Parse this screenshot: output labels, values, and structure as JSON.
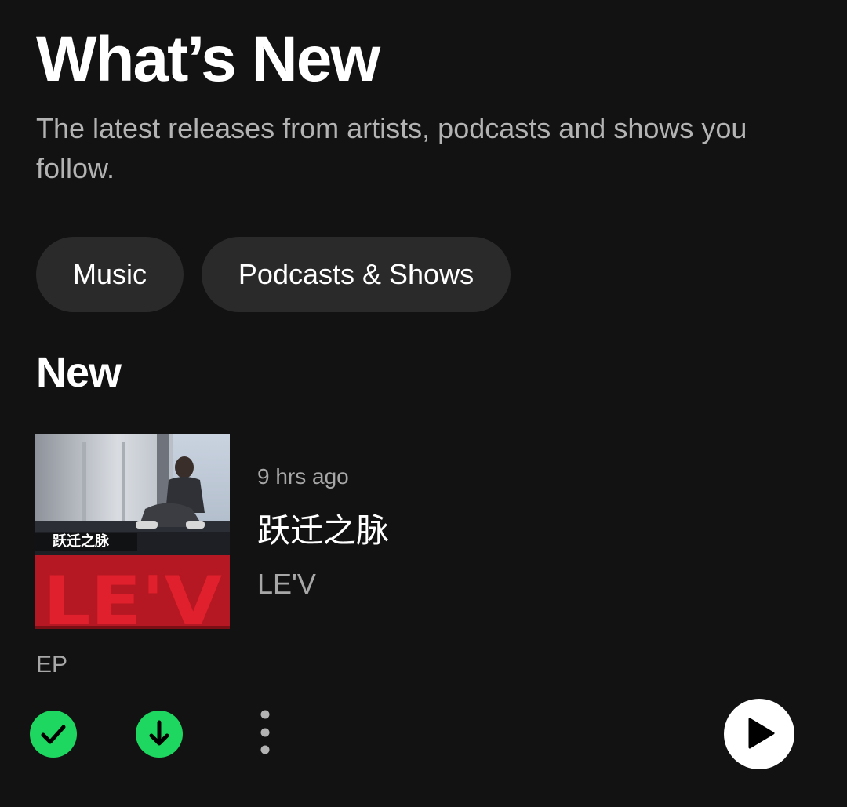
{
  "header": {
    "title": "What’s New",
    "subtitle": "The latest releases from artists, podcasts and shows you follow."
  },
  "filters": [
    {
      "label": "Music"
    },
    {
      "label": "Podcasts & Shows"
    }
  ],
  "section": {
    "title": "New"
  },
  "release": {
    "time": "9 hrs ago",
    "title": "跃迁之脉",
    "artist": "LE'V",
    "type": "EP",
    "cover": {
      "overlay_text": "跃迁之脉",
      "logo_text": "LE'V"
    }
  },
  "actions": {
    "added_icon": "check-circle-icon",
    "download_icon": "download-circle-icon",
    "more_icon": "more-vertical-icon",
    "play_icon": "play-icon"
  },
  "colors": {
    "background": "#121212",
    "accent": "#1ed760",
    "chip": "#2a2a2a",
    "secondary_text": "#a7a7a7",
    "cover_red": "#e0202c"
  }
}
